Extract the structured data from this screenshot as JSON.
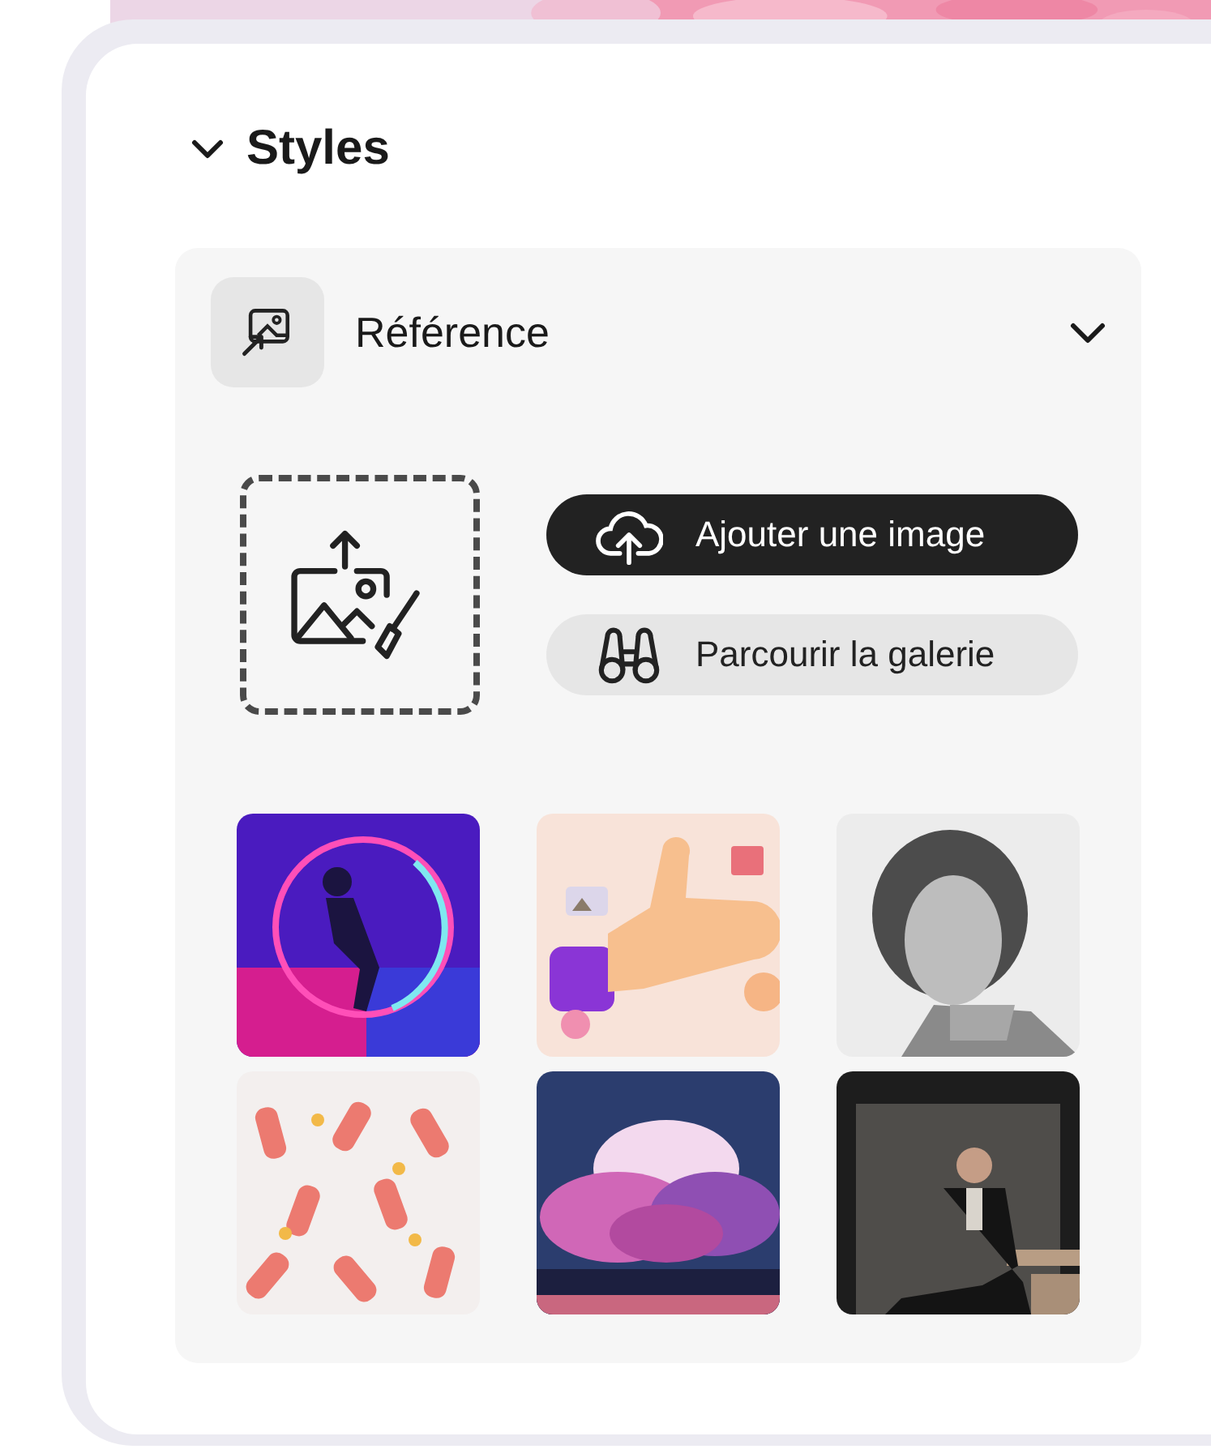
{
  "section": {
    "title": "Styles",
    "expanded": true
  },
  "reference": {
    "title": "Référence",
    "expanded": true
  },
  "actions": [
    {
      "kind": "upload",
      "label": "Ajouter une image"
    },
    {
      "kind": "browse",
      "label": "Parcourir la galerie"
    }
  ]
}
